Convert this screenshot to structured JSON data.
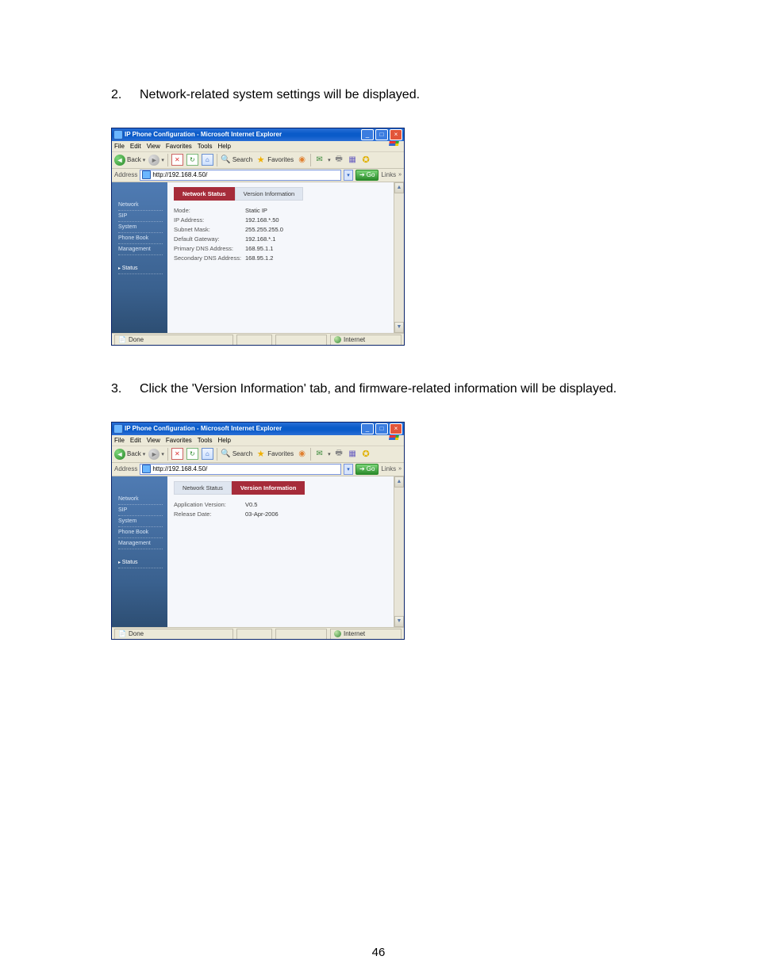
{
  "steps": {
    "s2": {
      "num": "2.",
      "text": "Network-related system settings will be displayed."
    },
    "s3": {
      "num": "3.",
      "text": "Click the 'Version Information' tab, and firmware-related information will be displayed."
    }
  },
  "window": {
    "title": "IP Phone Configuration - Microsoft Internet Explorer",
    "menu": {
      "file": "File",
      "edit": "Edit",
      "view": "View",
      "favorites": "Favorites",
      "tools": "Tools",
      "help": "Help"
    },
    "toolbar": {
      "back": "Back",
      "search": "Search",
      "favorites": "Favorites"
    },
    "address_label": "Address",
    "go": "Go",
    "links": "Links",
    "status_done": "Done",
    "status_zone": "Internet"
  },
  "shot1": {
    "url": "http://192.168.4.50/",
    "sidebar": [
      "Network",
      "SIP",
      "System",
      "Phone Book",
      "Management"
    ],
    "sidebar_active": "Status",
    "tabs": {
      "a": "Network Status",
      "b": "Version Information"
    },
    "rows": [
      {
        "k": "Mode:",
        "v": "Static IP"
      },
      {
        "k": "IP Address:",
        "v": "192.168.*.50"
      },
      {
        "k": "Subnet Mask:",
        "v": "255.255.255.0"
      },
      {
        "k": "Default Gateway:",
        "v": "192.168.*.1"
      },
      {
        "k": "Primary DNS Address:",
        "v": "168.95.1.1"
      },
      {
        "k": "Secondary DNS Address:",
        "v": "168.95.1.2"
      }
    ]
  },
  "shot2": {
    "url": "http://192.168.4.50/",
    "sidebar": [
      "Network",
      "SIP",
      "System",
      "Phone Book",
      "Management"
    ],
    "sidebar_active": "Status",
    "tabs": {
      "a": "Network Status",
      "b": "Version Information"
    },
    "rows": [
      {
        "k": "Application Version:",
        "v": "V0.5"
      },
      {
        "k": "Release Date:",
        "v": "03-Apr-2006"
      }
    ]
  },
  "page_number": "46"
}
